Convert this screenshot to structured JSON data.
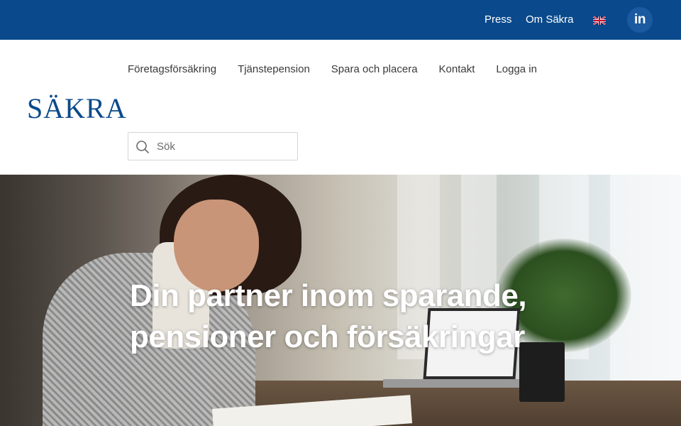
{
  "topbar": {
    "background": "#0a4a8c",
    "press_label": "Press",
    "om_label": "Om Säkra",
    "language_icon": "uk-flag-icon",
    "linkedin_label": "in",
    "linkedin_icon": "linkedin-icon"
  },
  "nav": {
    "items": [
      {
        "label": "Företagsförsäkring"
      },
      {
        "label": "Tjänstepension"
      },
      {
        "label": "Spara och placera"
      },
      {
        "label": "Kontakt"
      },
      {
        "label": "Logga in"
      }
    ]
  },
  "logo": {
    "text": "SÄKRA",
    "color": "#0a4a8c"
  },
  "search": {
    "placeholder": "Sök",
    "icon": "search-icon"
  },
  "hero": {
    "headline_line1": "Din partner inom sparande,",
    "headline_line2": "pensioner och försäkringar"
  }
}
